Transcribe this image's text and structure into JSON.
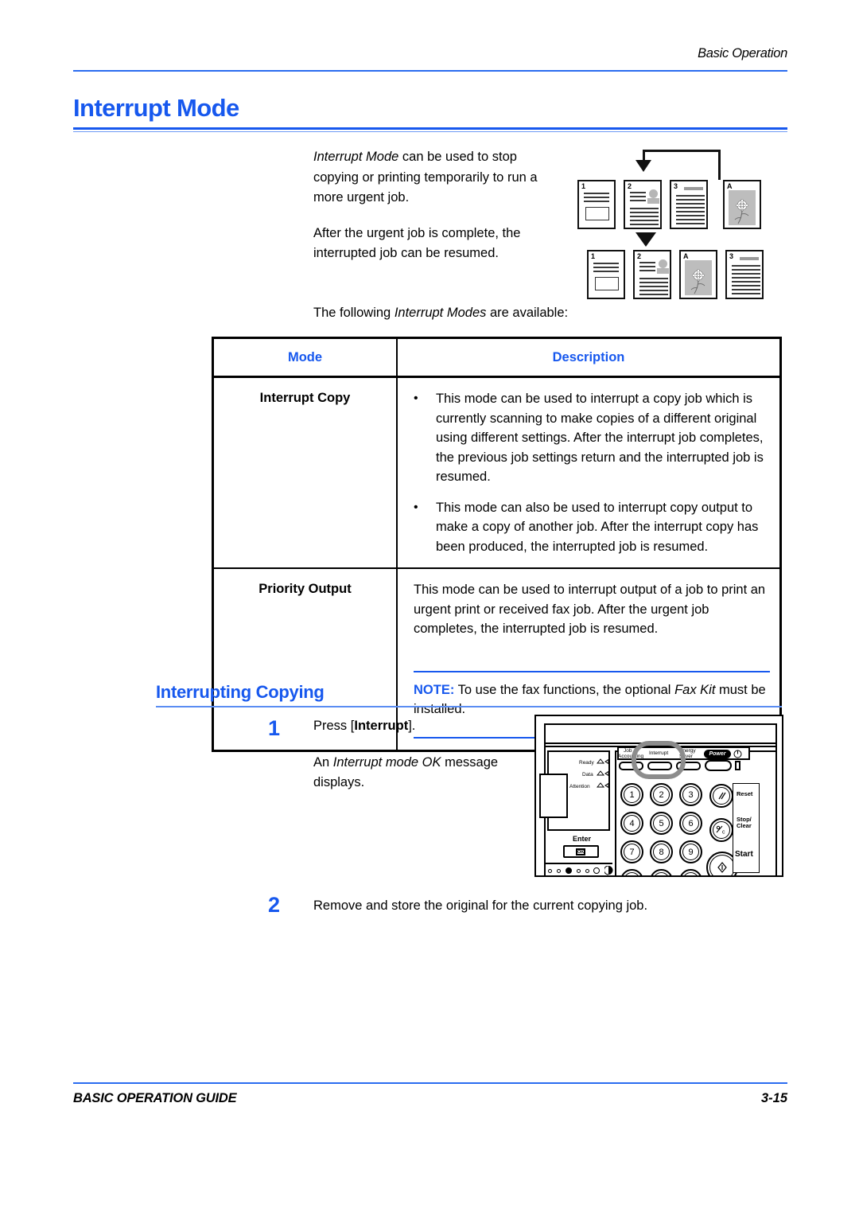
{
  "header": {
    "running_title": "Basic Operation"
  },
  "h1": {
    "title": "Interrupt Mode"
  },
  "intro": {
    "p1_em": "Interrupt Mode",
    "p1_rest": " can be used to stop copying or printing temporarily to run a more urgent job.",
    "p2": "After the urgent job is complete, the interrupted job can be resumed.",
    "p3_before": "The following ",
    "p3_em": "Interrupt Modes",
    "p3_after": " are available:"
  },
  "diagram": {
    "name": "interrupt-mode-flow-diagram",
    "top_row_labels": [
      "1",
      "2",
      "3",
      "A"
    ],
    "bottom_row_labels": [
      "1",
      "2",
      "A",
      "3"
    ]
  },
  "table": {
    "headers": {
      "mode": "Mode",
      "description": "Description"
    },
    "rows": [
      {
        "mode": "Interrupt Copy",
        "bullets": [
          "This mode can be used to interrupt a copy job which is currently scanning to make copies of a different original using different settings. After the interrupt job completes, the previous job settings return and the interrupted job is resumed.",
          "This mode can also be used to interrupt copy output to make a copy of another job. After the interrupt copy has been produced, the interrupted job is resumed."
        ],
        "bullet_glyph": "•"
      },
      {
        "mode": "Priority Output",
        "paragraph": "This mode can be used to interrupt output of a job to print an urgent print or received fax job. After the urgent job completes, the interrupted job is resumed.",
        "note": {
          "label": "NOTE:",
          "text_before": " To use the fax functions, the optional ",
          "em": "Fax Kit",
          "text_after": " must be installed."
        }
      }
    ]
  },
  "h2": {
    "title": "Interrupting Copying"
  },
  "steps": [
    {
      "number": "1",
      "line1_before": "Press [",
      "line1_bold": "Interrupt",
      "line1_after": "].",
      "line2_before": "An ",
      "line2_em": "Interrupt mode OK",
      "line2_after": " message displays."
    },
    {
      "number": "2",
      "text": "Remove and store the original for the current copying job."
    }
  ],
  "control_panel": {
    "name": "operation-panel-illustration",
    "button_labels": {
      "job_accounting_line1": "Job",
      "job_accounting_line2": "Accounting",
      "interrupt": "Interrupt",
      "energy_line1": "Energy",
      "energy_line2": "Saver",
      "power": "Power",
      "reset": "Reset",
      "stop_line1": "Stop/",
      "stop_line2": "Clear",
      "start": "Start",
      "enter": "Enter",
      "enter_key": "OK"
    },
    "indicators": [
      "Ready",
      "Data",
      "Attention"
    ],
    "numeric_keys": [
      "1",
      "2",
      "3",
      "4",
      "5",
      "6",
      "7",
      "8",
      "9"
    ]
  },
  "footer": {
    "left": "BASIC OPERATION GUIDE",
    "right": "3-15"
  },
  "colors": {
    "accent_blue": "#1758ee",
    "rule_blue": "#2b6cf0",
    "text_black": "#000000"
  }
}
